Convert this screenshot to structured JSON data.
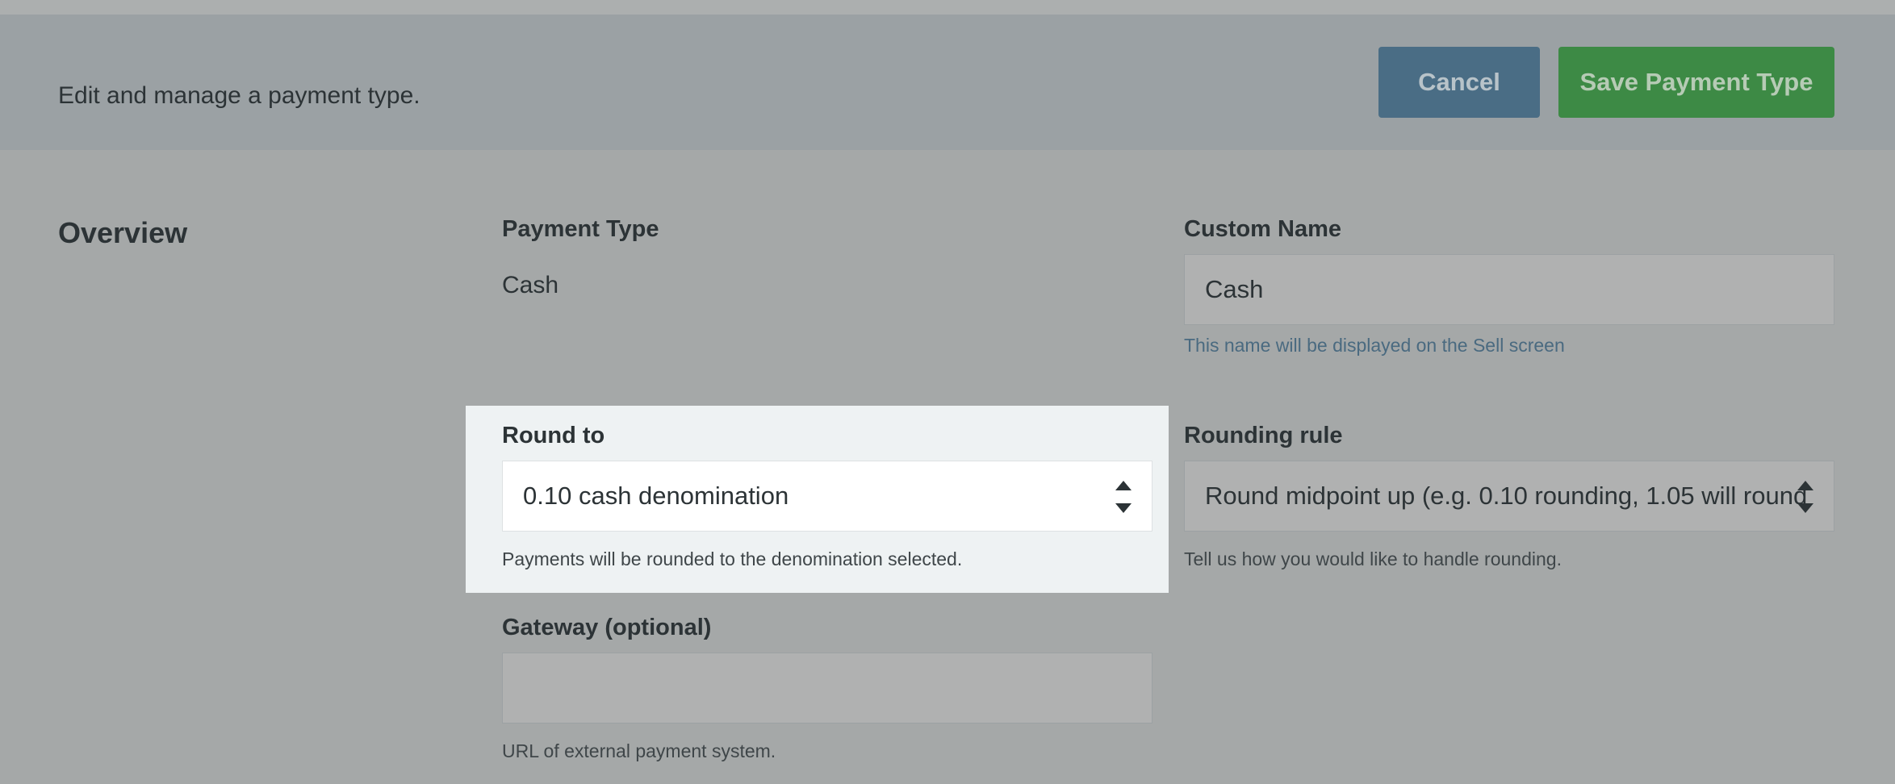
{
  "header": {
    "description": "Edit and manage a payment type.",
    "cancel_label": "Cancel",
    "save_label": "Save Payment Type"
  },
  "section": {
    "title": "Overview"
  },
  "payment_type": {
    "label": "Payment Type",
    "value": "Cash"
  },
  "custom_name": {
    "label": "Custom Name",
    "value": "Cash",
    "help": "This name will be displayed on the Sell screen"
  },
  "round_to": {
    "label": "Round to",
    "selected": "0.10 cash denomination",
    "help": "Payments will be rounded to the denomination selected."
  },
  "rounding_rule": {
    "label": "Rounding rule",
    "selected": "Round midpoint up (e.g. 0.10 rounding, 1.05 will round",
    "help": "Tell us how you would like to handle rounding."
  },
  "gateway": {
    "label": "Gateway (optional)",
    "value": "",
    "help": "URL of external payment system."
  },
  "colors": {
    "accent_blue": "#4a6d85",
    "accent_green": "#3d8a45",
    "highlight_bg": "#eef2f3"
  },
  "icons": {
    "select_spinner": "up-down-arrows-icon"
  }
}
